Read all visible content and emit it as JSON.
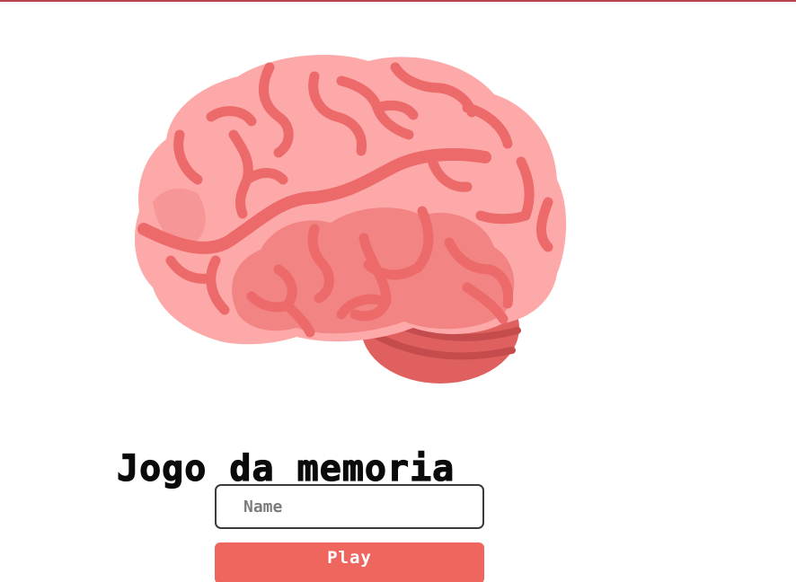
{
  "app": {
    "title": "Jogo da memoria"
  },
  "logo": {
    "icon": "brain-icon"
  },
  "form": {
    "name_placeholder": "Name",
    "name_value": "",
    "play_label": "Play"
  },
  "colors": {
    "accent": "#ee665d",
    "brain_light": "#fda9aa",
    "brain_groove": "#ec6a6a",
    "cerebellum": "#e0605f",
    "cerebellum_stripe": "#c44c4d",
    "top_border": "#b5464b"
  }
}
